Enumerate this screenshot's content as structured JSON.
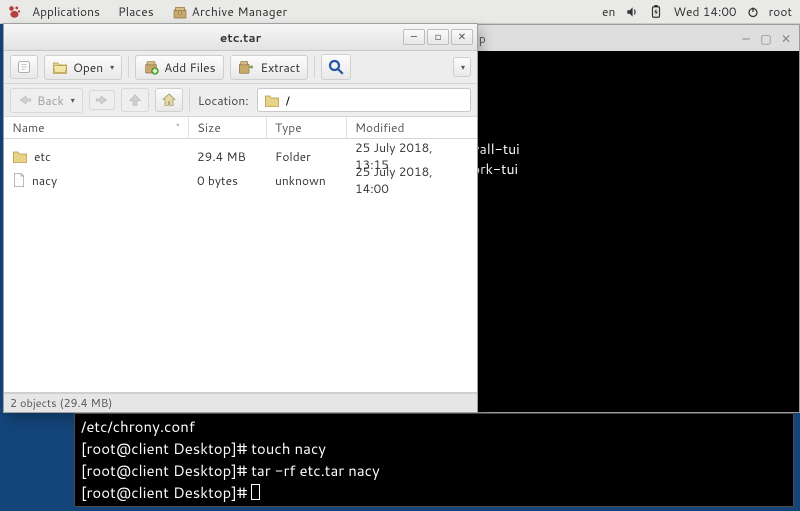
{
  "panel": {
    "applications": "Applications",
    "places": "Places",
    "app_name": "Archive Manager",
    "lang": "en",
    "clock": "Wed 14:00",
    "user": "root"
  },
  "bg_terminal": {
    "title": "sktop",
    "lines": [
      "rewall-tui",
      "twork-tui"
    ]
  },
  "archive": {
    "title": "etc.tar",
    "toolbar": {
      "open": "Open",
      "add_files": "Add Files",
      "extract": "Extract"
    },
    "nav": {
      "back": "Back",
      "location_label": "Location:",
      "path": "/"
    },
    "columns": {
      "name": "Name",
      "size": "Size",
      "type": "Type",
      "modified": "Modified"
    },
    "rows": [
      {
        "icon": "folder",
        "name": "etc",
        "size": "29.4 MB",
        "type": "Folder",
        "modified": "25 July 2018, 13:15"
      },
      {
        "icon": "file",
        "name": "nacy",
        "size": "0 bytes",
        "type": "unknown",
        "modified": "25 July 2018, 14:00"
      }
    ],
    "status": "2 objects (29.4 MB)"
  },
  "fg_terminal": {
    "lines": [
      "/etc/chrony.conf",
      "[root@client Desktop]# touch nacy",
      "[root@client Desktop]# tar -rf etc.tar nacy",
      "[root@client Desktop]# "
    ]
  }
}
